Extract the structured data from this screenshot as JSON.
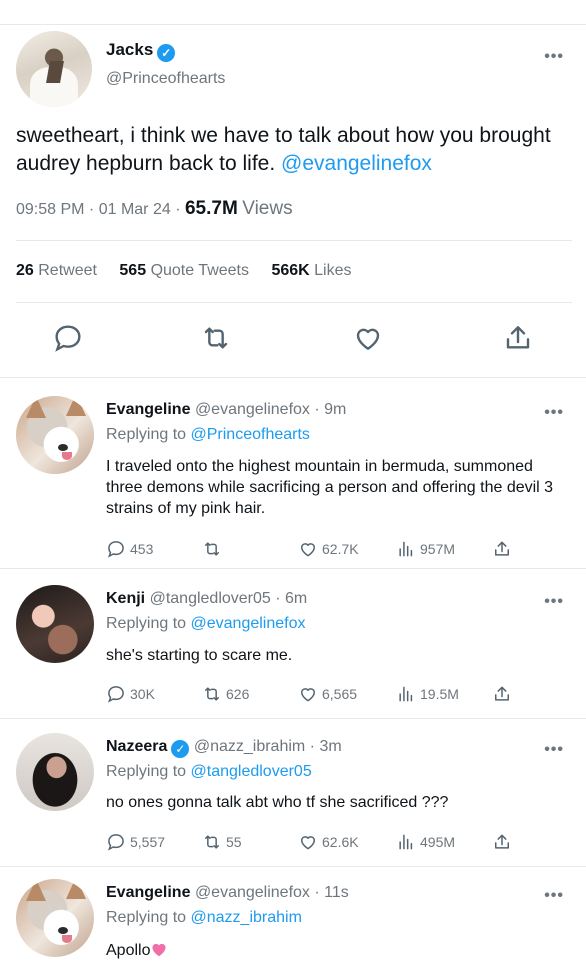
{
  "tweet": {
    "author_name": "Jacks",
    "author_handle": "@Princeofhearts",
    "text": "sweetheart, i think we have to talk about how you brought audrey hepburn back to life.",
    "mention": "@evangelinefox",
    "timestamp": "09:58 PM · 01 Mar 24 ·",
    "views_count": "65.7M",
    "views_label": "Views",
    "more_label": "•••",
    "retweets_count": "26",
    "retweets_label": "Retweet",
    "quotes_count": "565",
    "quotes_label": "Quote Tweets",
    "likes_count": "566K",
    "likes_label": "Likes"
  },
  "replies": [
    {
      "name": "Evangeline",
      "handle": "@evangelinefox · 9m",
      "replying_prefix": "Replying to",
      "replying_to": "@Princeofhearts",
      "text": "I traveled onto the highest mountain in bermuda, summoned three demons while sacrificing a person and offering the devil 3 strains of my pink hair.",
      "comments": "453",
      "retweets": "",
      "likes": "62.7K",
      "views": "957M",
      "verified": false
    },
    {
      "name": "Kenji",
      "handle": "@tangledlover05 · 6m",
      "replying_prefix": "Replying to",
      "replying_to": "@evangelinefox",
      "text": "she's starting to scare me.",
      "comments": "30K",
      "retweets": "626",
      "likes": "6,565",
      "views": "19.5M",
      "verified": false
    },
    {
      "name": "Nazeera",
      "handle": "@nazz_ibrahim · 3m",
      "replying_prefix": "Replying to",
      "replying_to": "@tangledlover05",
      "text": "no ones gonna talk abt who tf she sacrificed ???",
      "comments": "5,557",
      "retweets": "55",
      "likes": "62.6K",
      "views": "495M",
      "verified": true
    },
    {
      "name": "Evangeline",
      "handle": "@evangelinefox · 11s",
      "replying_prefix": "Replying to",
      "replying_to": "@nazz_ibrahim",
      "text": "Apollo",
      "verified": false
    }
  ],
  "colors": {
    "accent": "#1d9bf0",
    "muted": "#6e767d",
    "text": "#0f1419",
    "heart_emoji": "#f06fa8"
  },
  "icons": [
    "comment-icon",
    "retweet-icon",
    "like-icon",
    "share-icon",
    "views-icon",
    "verified-icon",
    "more-icon"
  ]
}
